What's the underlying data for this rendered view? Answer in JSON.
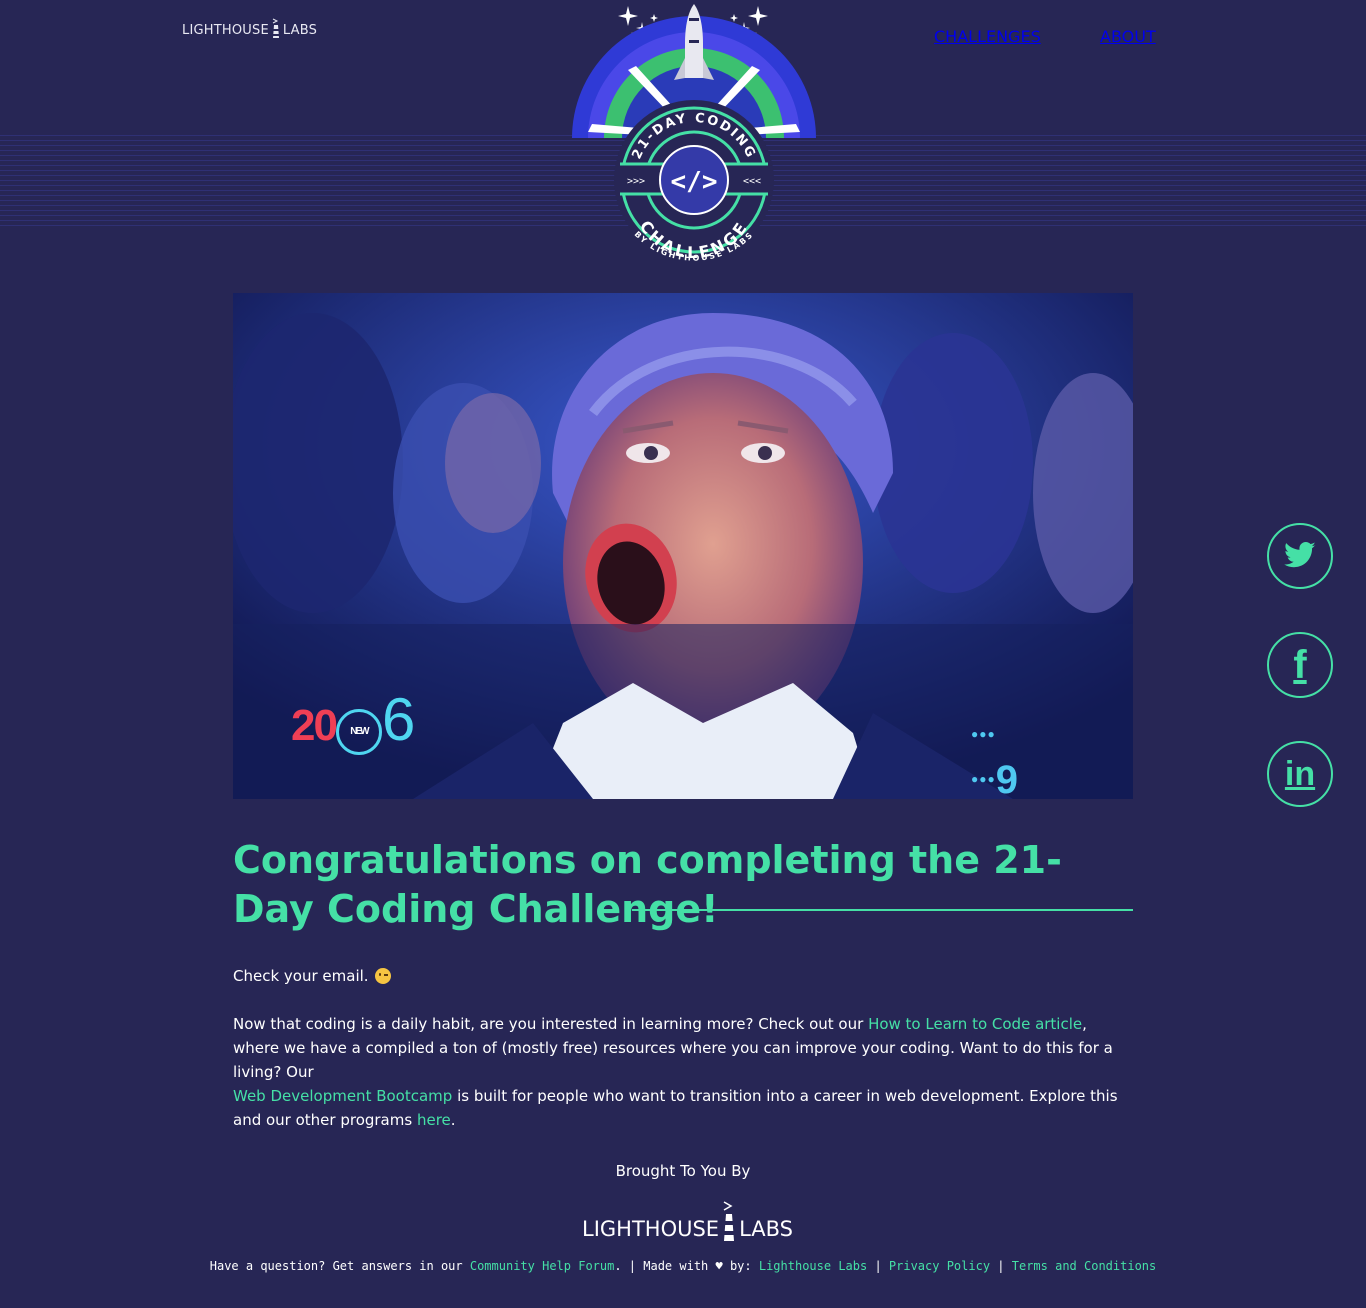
{
  "header": {
    "logo_left": "LIGHTHOUSE",
    "logo_right": "LABS",
    "nav": [
      {
        "label": "CHALLENGES"
      },
      {
        "label": "ABOUT"
      }
    ]
  },
  "badge": {
    "ring_top": "21-DAY CODING",
    "code_symbol": "</>",
    "arrows_left": ">>>",
    "arrows_right": "<<<",
    "ring_bottom": "CHALLENGE",
    "byline": "BY LIGHTHOUSE LABS"
  },
  "hero": {
    "overlay_year_prefix": "20",
    "overlay_year_badge": "NEW",
    "overlay_year_suffix": "6",
    "overlay_channel": "9"
  },
  "main": {
    "heading": "Congratulations on completing the 21-Day Coding Challenge!",
    "check_email": "Check your email.",
    "p1_a": "Now that coding is a daily habit, are you interested in learning more? Check out our ",
    "p1_link1": "How to Learn to Code article",
    "p1_b": ", where we have a compiled a ton of (mostly free) resources where you can improve your coding. Want to do this for a living? Our ",
    "p1_link2": "Web Development Bootcamp",
    "p1_c": " is built for people who want to transition into a career in web development. Explore this and our other programs ",
    "p1_link3": "here",
    "p1_d": "."
  },
  "social": [
    {
      "icon": "twitter-icon"
    },
    {
      "icon": "facebook-icon",
      "glyph": "f"
    },
    {
      "icon": "linkedin-icon",
      "glyph": "in"
    }
  ],
  "footer": {
    "brought_by": "Brought To You By",
    "logo_left": "LIGHTHOUSE",
    "logo_right": "LABS",
    "question_text": "Have a question? Get answers in our ",
    "forum_link": "Community Help Forum",
    "made_with_text": ". | Made with ♥ by: ",
    "lhl_link": "Lighthouse Labs",
    "sep1": " | ",
    "privacy_link": "Privacy Policy",
    "sep2": " | ",
    "terms_link": "Terms and Conditions"
  },
  "colors": {
    "background": "#272655",
    "accent": "#45e0a6"
  }
}
